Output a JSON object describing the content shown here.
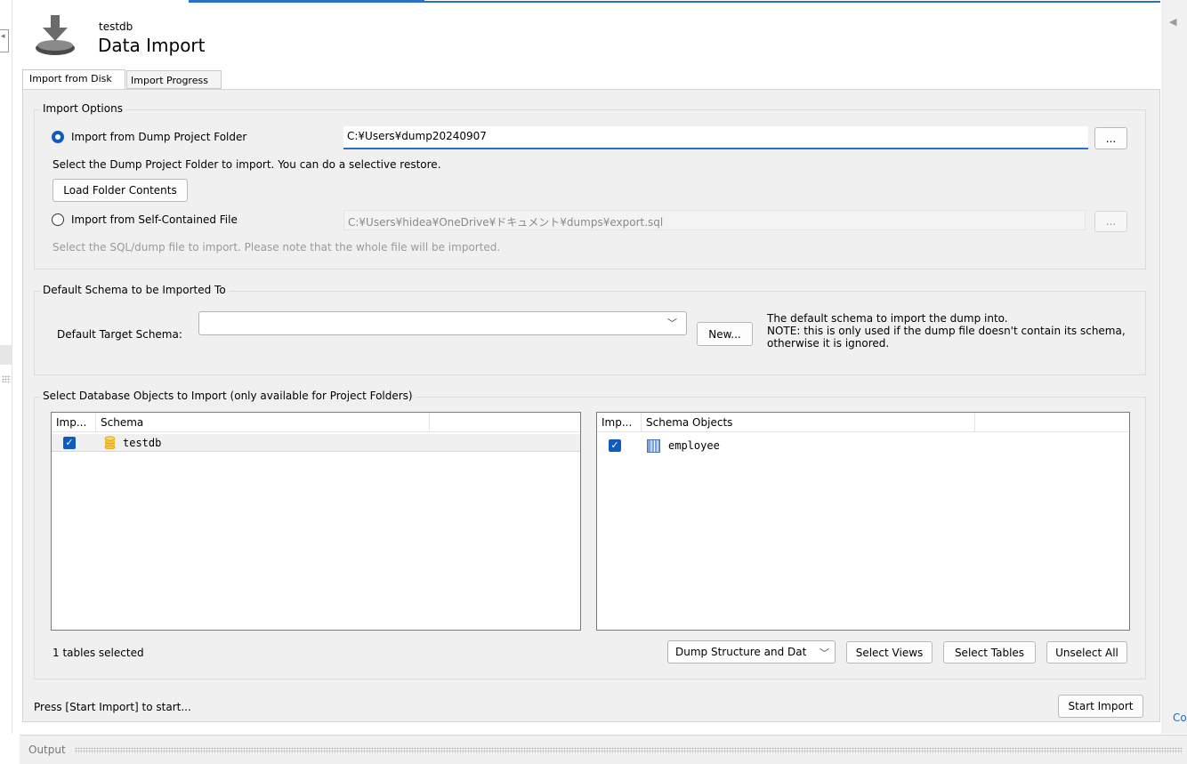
{
  "header": {
    "schema_name": "testdb",
    "title": "Data Import",
    "icon": "import-download-icon"
  },
  "tabs": [
    {
      "label": "Import from Disk",
      "active": true
    },
    {
      "label": "Import Progress",
      "active": false
    }
  ],
  "import_options": {
    "legend": "Import Options",
    "folder_option": {
      "label": "Import from Dump Project Folder",
      "selected": true,
      "path": "C:¥Users¥dump20240907",
      "browse_label": "...",
      "hint": "Select the Dump Project Folder to import. You can do a selective restore.",
      "load_button": "Load Folder Contents"
    },
    "file_option": {
      "label": "Import from Self-Contained File",
      "selected": false,
      "path": "C:¥Users¥hidea¥OneDrive¥ドキュメント¥dumps¥export.sql",
      "browse_label": "...",
      "hint": "Select the SQL/dump file to import. Please note that the whole file will be imported."
    }
  },
  "default_schema": {
    "legend": "Default Schema to be Imported To",
    "label": "Default Target Schema:",
    "value": "",
    "new_button": "New...",
    "note_line1": "The default schema to import the dump into.",
    "note_line2": "NOTE: this is only used if the dump file doesn't contain its schema,",
    "note_line3": "otherwise it is ignored."
  },
  "objects": {
    "legend": "Select Database Objects to Import (only available for Project Folders)",
    "schema_list": {
      "columns": [
        "Imp...",
        "Schema"
      ],
      "rows": [
        {
          "checked": true,
          "icon": "database-icon",
          "name": "testdb"
        }
      ]
    },
    "objects_list": {
      "columns": [
        "Imp...",
        "Schema Objects"
      ],
      "rows": [
        {
          "checked": true,
          "icon": "table-icon",
          "name": "employee"
        }
      ]
    },
    "selection_status": "1 tables selected",
    "dump_type": "Dump Structure and Dat",
    "select_views": "Select Views",
    "select_tables": "Select Tables",
    "unselect_all": "Unselect All"
  },
  "footer": {
    "status": "Press [Start Import] to start...",
    "start_button": "Start Import"
  },
  "output": {
    "label": "Output"
  },
  "right_edge": {
    "partial_text": "Co"
  },
  "colors": {
    "accent": "#2a70c9",
    "checkbox": "#0f5bbf",
    "panel": "#f0f0f0"
  }
}
